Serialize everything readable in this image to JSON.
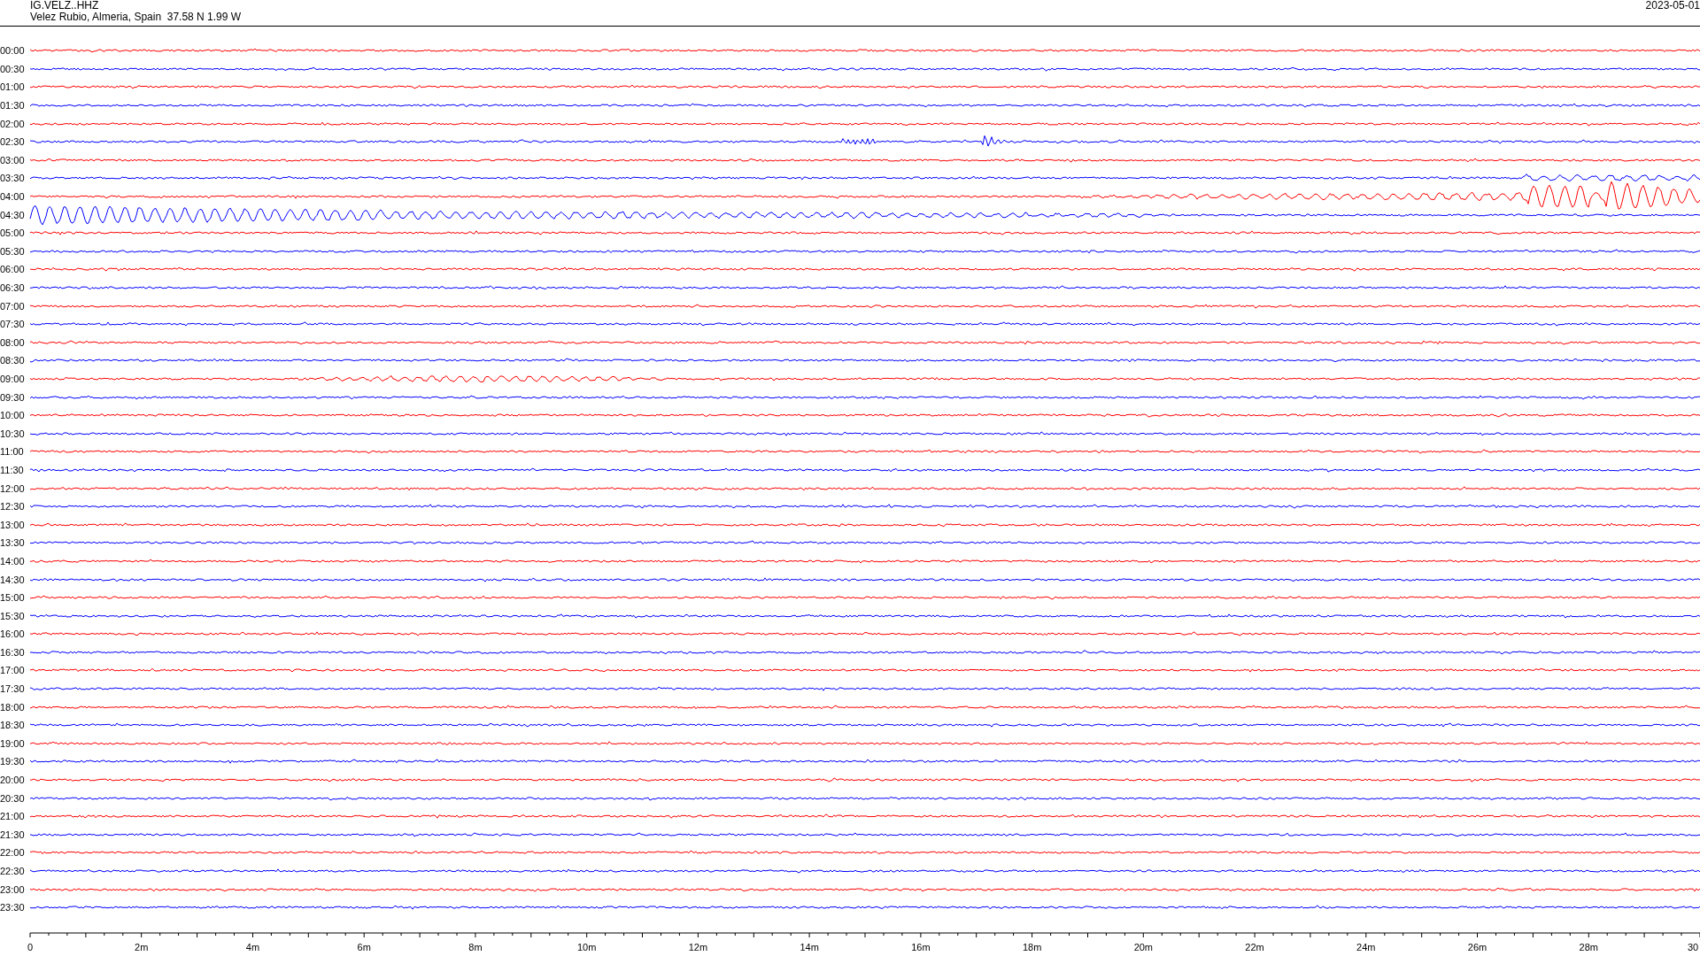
{
  "header": {
    "station": "IG.VELZ..HHZ",
    "location": "Velez Rubio, Almeria, Spain  37.58 N 1.99 W",
    "date": "2023-05-01"
  },
  "traces": [
    {
      "time": "00:00",
      "color": "#ff0000"
    },
    {
      "time": "00:30",
      "color": "#0000ff"
    },
    {
      "time": "01:00",
      "color": "#ff0000"
    },
    {
      "time": "01:30",
      "color": "#0000ff"
    },
    {
      "time": "02:00",
      "color": "#ff0000"
    },
    {
      "time": "02:30",
      "color": "#0000ff"
    },
    {
      "time": "03:00",
      "color": "#ff0000"
    },
    {
      "time": "03:30",
      "color": "#0000ff"
    },
    {
      "time": "04:00",
      "color": "#ff0000"
    },
    {
      "time": "04:30",
      "color": "#0000ff"
    },
    {
      "time": "05:00",
      "color": "#ff0000"
    },
    {
      "time": "05:30",
      "color": "#0000ff"
    },
    {
      "time": "06:00",
      "color": "#ff0000"
    },
    {
      "time": "06:30",
      "color": "#0000ff"
    },
    {
      "time": "07:00",
      "color": "#ff0000"
    },
    {
      "time": "07:30",
      "color": "#0000ff"
    },
    {
      "time": "08:00",
      "color": "#ff0000"
    },
    {
      "time": "08:30",
      "color": "#0000ff"
    },
    {
      "time": "09:00",
      "color": "#ff0000"
    },
    {
      "time": "09:30",
      "color": "#0000ff"
    },
    {
      "time": "10:00",
      "color": "#ff0000"
    },
    {
      "time": "10:30",
      "color": "#0000ff"
    },
    {
      "time": "11:00",
      "color": "#ff0000"
    },
    {
      "time": "11:30",
      "color": "#0000ff"
    },
    {
      "time": "12:00",
      "color": "#ff0000"
    },
    {
      "time": "12:30",
      "color": "#0000ff"
    },
    {
      "time": "13:00",
      "color": "#ff0000"
    },
    {
      "time": "13:30",
      "color": "#0000ff"
    },
    {
      "time": "14:00",
      "color": "#ff0000"
    },
    {
      "time": "14:30",
      "color": "#0000ff"
    },
    {
      "time": "15:00",
      "color": "#ff0000"
    },
    {
      "time": "15:30",
      "color": "#0000ff"
    },
    {
      "time": "16:00",
      "color": "#ff0000"
    },
    {
      "time": "16:30",
      "color": "#0000ff"
    },
    {
      "time": "17:00",
      "color": "#ff0000"
    },
    {
      "time": "17:30",
      "color": "#0000ff"
    },
    {
      "time": "18:00",
      "color": "#ff0000"
    },
    {
      "time": "18:30",
      "color": "#0000ff"
    },
    {
      "time": "19:00",
      "color": "#ff0000"
    },
    {
      "time": "19:30",
      "color": "#0000ff"
    },
    {
      "time": "20:00",
      "color": "#ff0000"
    },
    {
      "time": "20:30",
      "color": "#0000ff"
    },
    {
      "time": "21:00",
      "color": "#ff0000"
    },
    {
      "time": "21:30",
      "color": "#0000ff"
    },
    {
      "time": "22:00",
      "color": "#ff0000"
    },
    {
      "time": "22:30",
      "color": "#0000ff"
    },
    {
      "time": "23:00",
      "color": "#ff0000"
    },
    {
      "time": "23:30",
      "color": "#0000ff"
    }
  ],
  "x_axis": {
    "labels": [
      "0",
      "2m",
      "4m",
      "6m",
      "8m",
      "10m",
      "12m",
      "14m",
      "16m",
      "18m",
      "20m",
      "22m",
      "24m",
      "26m",
      "28m",
      "30"
    ]
  }
}
